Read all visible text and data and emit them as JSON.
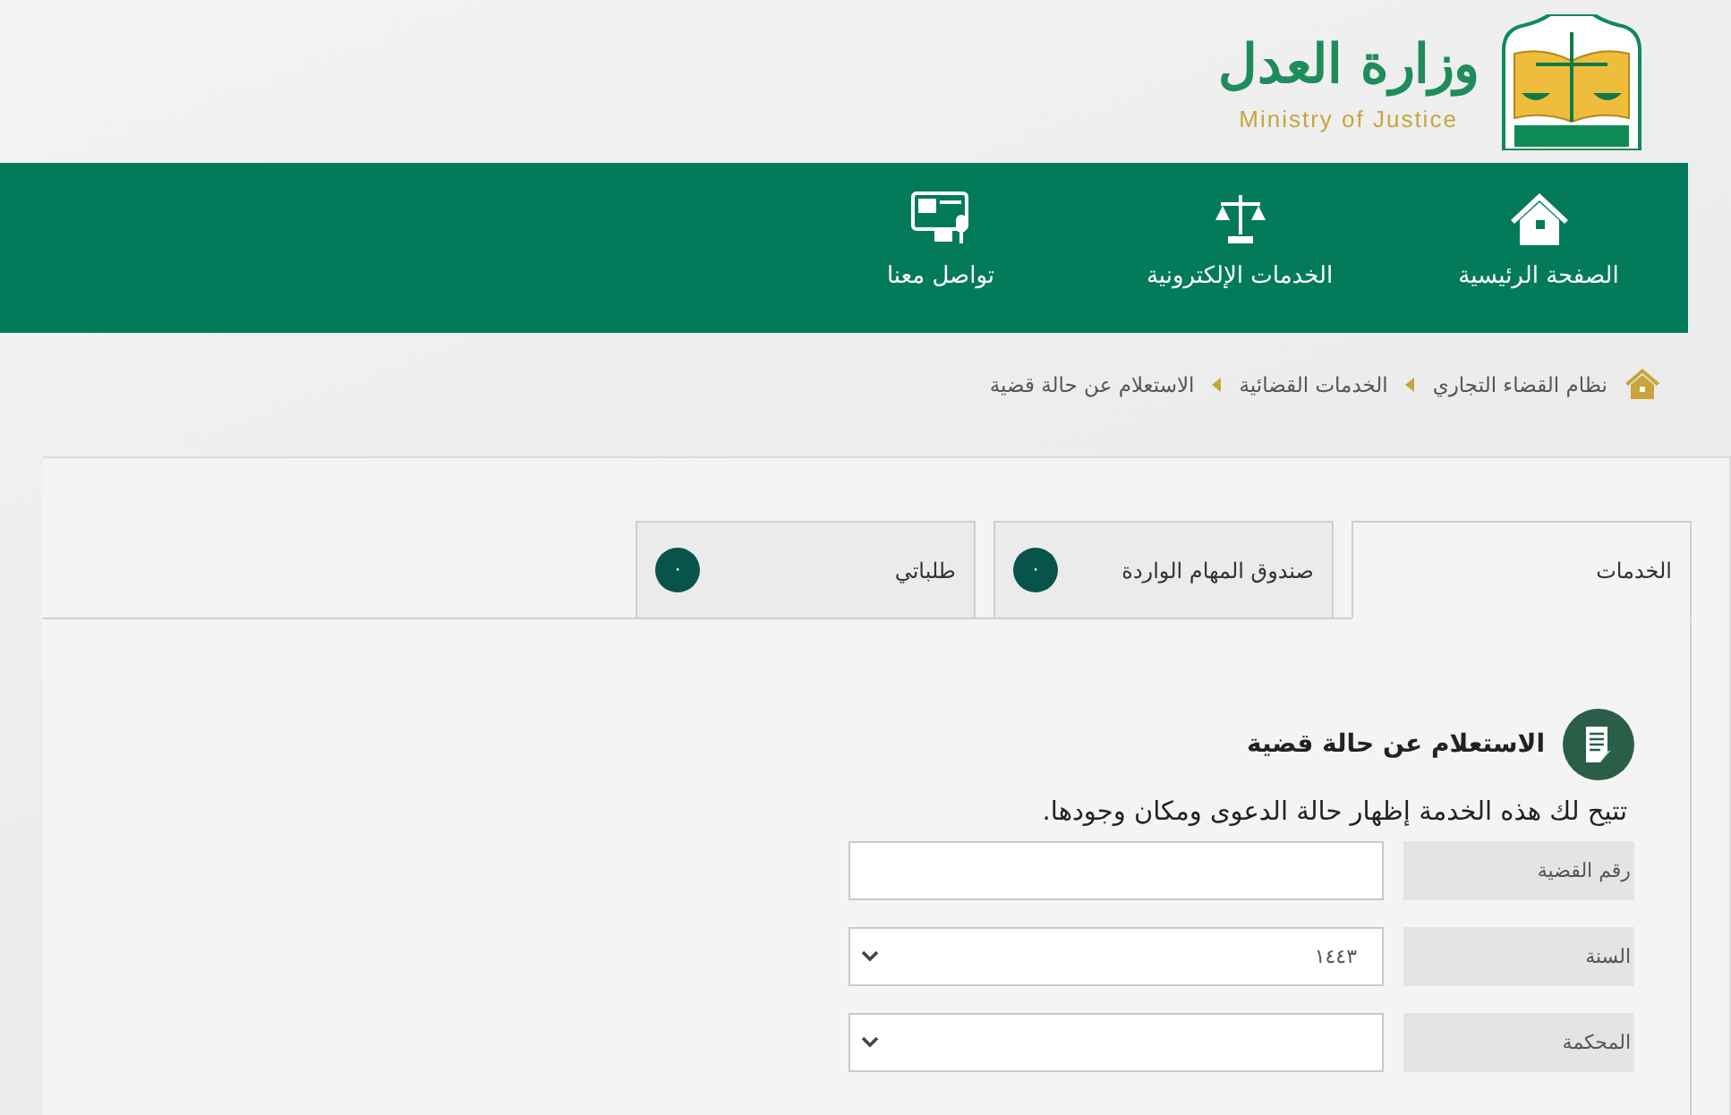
{
  "header": {
    "logo_arabic": "وزارة العدل",
    "logo_english": "Ministry of Justice"
  },
  "nav": {
    "items": [
      {
        "label": "الصفحة الرئيسية",
        "kind": "home"
      },
      {
        "label": "الخدمات الإلكترونية",
        "kind": "scales"
      },
      {
        "label": "تواصل معنا",
        "kind": "contact"
      }
    ]
  },
  "breadcrumb": [
    "نظام القضاء التجاري",
    "الخدمات القضائية",
    "الاستعلام عن حالة قضية"
  ],
  "tabs": [
    {
      "label": "الخدمات",
      "selected": true
    },
    {
      "label": "صندوق المهام الواردة",
      "selected": false,
      "badge": "٠"
    },
    {
      "label": "طلباتي",
      "selected": false,
      "badge": "٠"
    }
  ],
  "service": {
    "title": "الاستعلام عن حالة قضية",
    "description": "تتيح لك هذه الخدمة إظهار حالة الدعوى ومكان وجودها.",
    "fields": [
      {
        "label": "رقم القضية",
        "kind": "text"
      },
      {
        "label": "السنة",
        "kind": "select",
        "value": "١٤٤٣"
      },
      {
        "label": "المحكمة",
        "kind": "select"
      }
    ]
  }
}
